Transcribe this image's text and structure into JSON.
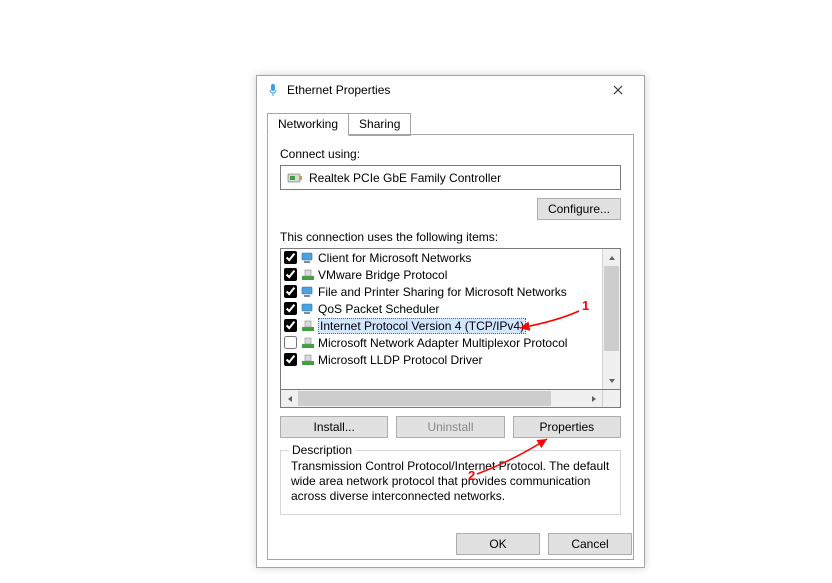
{
  "window": {
    "title": "Ethernet Properties"
  },
  "tabs": {
    "networking": "Networking",
    "sharing": "Sharing"
  },
  "connect_using_label": "Connect using:",
  "adapter_name": "Realtek PCIe GbE Family Controller",
  "configure_btn": "Configure...",
  "items_label": "This connection uses the following items:",
  "items": [
    {
      "checked": true,
      "label": "Client for Microsoft Networks",
      "icon": "client"
    },
    {
      "checked": true,
      "label": "VMware Bridge Protocol",
      "icon": "proto"
    },
    {
      "checked": true,
      "label": "File and Printer Sharing for Microsoft Networks",
      "icon": "client"
    },
    {
      "checked": true,
      "label": "QoS Packet Scheduler",
      "icon": "client"
    },
    {
      "checked": true,
      "label": "Internet Protocol Version 4 (TCP/IPv4)",
      "icon": "proto",
      "selected": true
    },
    {
      "checked": false,
      "label": "Microsoft Network Adapter Multiplexor Protocol",
      "icon": "proto"
    },
    {
      "checked": true,
      "label": "Microsoft LLDP Protocol Driver",
      "icon": "proto"
    }
  ],
  "install_btn": "Install...",
  "uninstall_btn": "Uninstall",
  "properties_btn": "Properties",
  "desc_group": "Description",
  "desc_text": "Transmission Control Protocol/Internet Protocol. The default wide area network protocol that provides communication across diverse interconnected networks.",
  "ok_btn": "OK",
  "cancel_btn": "Cancel",
  "anno": {
    "one": "1",
    "two": "2"
  }
}
